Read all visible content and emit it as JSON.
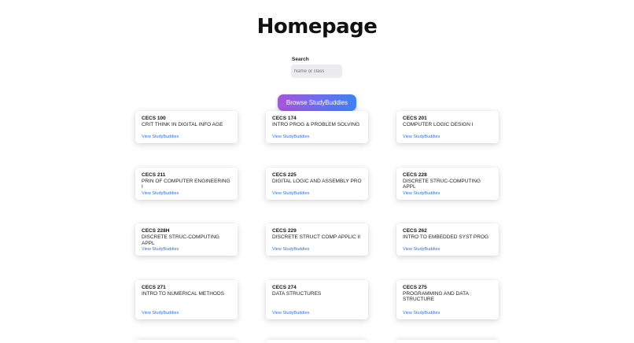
{
  "header": {
    "title": "Homepage"
  },
  "search": {
    "label": "Search",
    "placeholder": "Name or class",
    "value": ""
  },
  "browse_button": {
    "label": "Browse StudyBuddies"
  },
  "courses": [
    {
      "code": "CECS 100",
      "name": "CRIT THINK IN DIGITAL INFO AGE",
      "link": "View StudyBuddies"
    },
    {
      "code": "CECS 174",
      "name": "INTRO PROG & PROBLEM SOLVING",
      "link": "View StudyBuddies"
    },
    {
      "code": "CECS 201",
      "name": "COMPUTER LOGIC DESIGN I",
      "link": "View StudyBuddies"
    },
    {
      "code": "CECS 211",
      "name": "PRIN OF COMPUTER ENGINEERING I",
      "link": "View StudyBuddies"
    },
    {
      "code": "CECS 225",
      "name": "DIGITAL LOGIC AND ASSEMBLY PRO",
      "link": "View StudyBuddies"
    },
    {
      "code": "CECS 228",
      "name": "DISCRETE STRUC-COMPUTING APPL",
      "link": "View StudyBuddies"
    },
    {
      "code": "CECS 228H",
      "name": "DISCRETE STRUC-COMPUTING APPL",
      "link": "View StudyBuddies"
    },
    {
      "code": "CECS 229",
      "name": "DISCRETE STRUCT COMP APPLIC II",
      "link": "View StudyBuddies"
    },
    {
      "code": "CECS 262",
      "name": "INTRO TO EMBEDDED SYST PROG",
      "link": "View StudyBuddies"
    },
    {
      "code": "CECS 271",
      "name": "INTRO TO NUMERICAL METHODS",
      "link": "View StudyBuddies"
    },
    {
      "code": "CECS 274",
      "name": "DATA STRUCTURES",
      "link": "View StudyBuddies"
    },
    {
      "code": "CECS 275",
      "name": "PROGRAMMING AND DATA STRUCTURE",
      "link": "View StudyBuddies"
    }
  ]
}
